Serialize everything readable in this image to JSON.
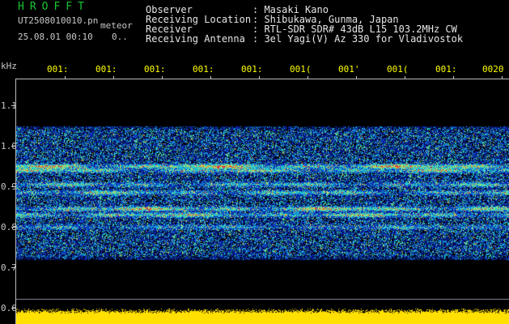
{
  "brand": {
    "title": "HROFFT"
  },
  "file": {
    "name": "UT2508010010.pn",
    "meteor_label": "meteor",
    "datetime": "25.08.01 00:10",
    "counter": "0.."
  },
  "header": {
    "rows": [
      {
        "label": "Observer",
        "value": ": Masaki Kano"
      },
      {
        "label": "Receiving Location",
        "value": ": Shibukawa, Gunma, Japan"
      },
      {
        "label": "Receiver",
        "value": ": RTL-SDR SDR# 43dB L15 103.2MHz CW"
      },
      {
        "label": "Receiving Antenna",
        "value": ": 3el Yagi(V) Az 330 for Vladivostok"
      }
    ]
  },
  "y_axis": {
    "unit": "kHz",
    "ticks": [
      "1.1",
      "1.0",
      "0.9",
      "0.8",
      "0.7",
      "0.6"
    ]
  },
  "time_axis": {
    "ticks": [
      "001:",
      "001:",
      "001:",
      "001:",
      "001:",
      "001(",
      "001'",
      "001(",
      "001:",
      "0020"
    ]
  },
  "colors": {
    "background": "#000000",
    "noise": "#1020b0",
    "band_strong": "#e03030",
    "band_mid": "#20d0c0",
    "signal_strip": "#ffe000",
    "brand": "#18c832",
    "time_tick": "#ffff00"
  },
  "spectrogram": {
    "bands_khz": [
      0.95,
      0.94,
      0.905,
      0.885,
      0.845,
      0.83,
      0.8
    ],
    "band_strengths": [
      1.0,
      0.7,
      0.55,
      0.6,
      0.9,
      0.75,
      0.4
    ],
    "noise_top_khz": 1.05,
    "noise_bottom_khz": 0.72,
    "strip_top_khz": 0.605
  }
}
